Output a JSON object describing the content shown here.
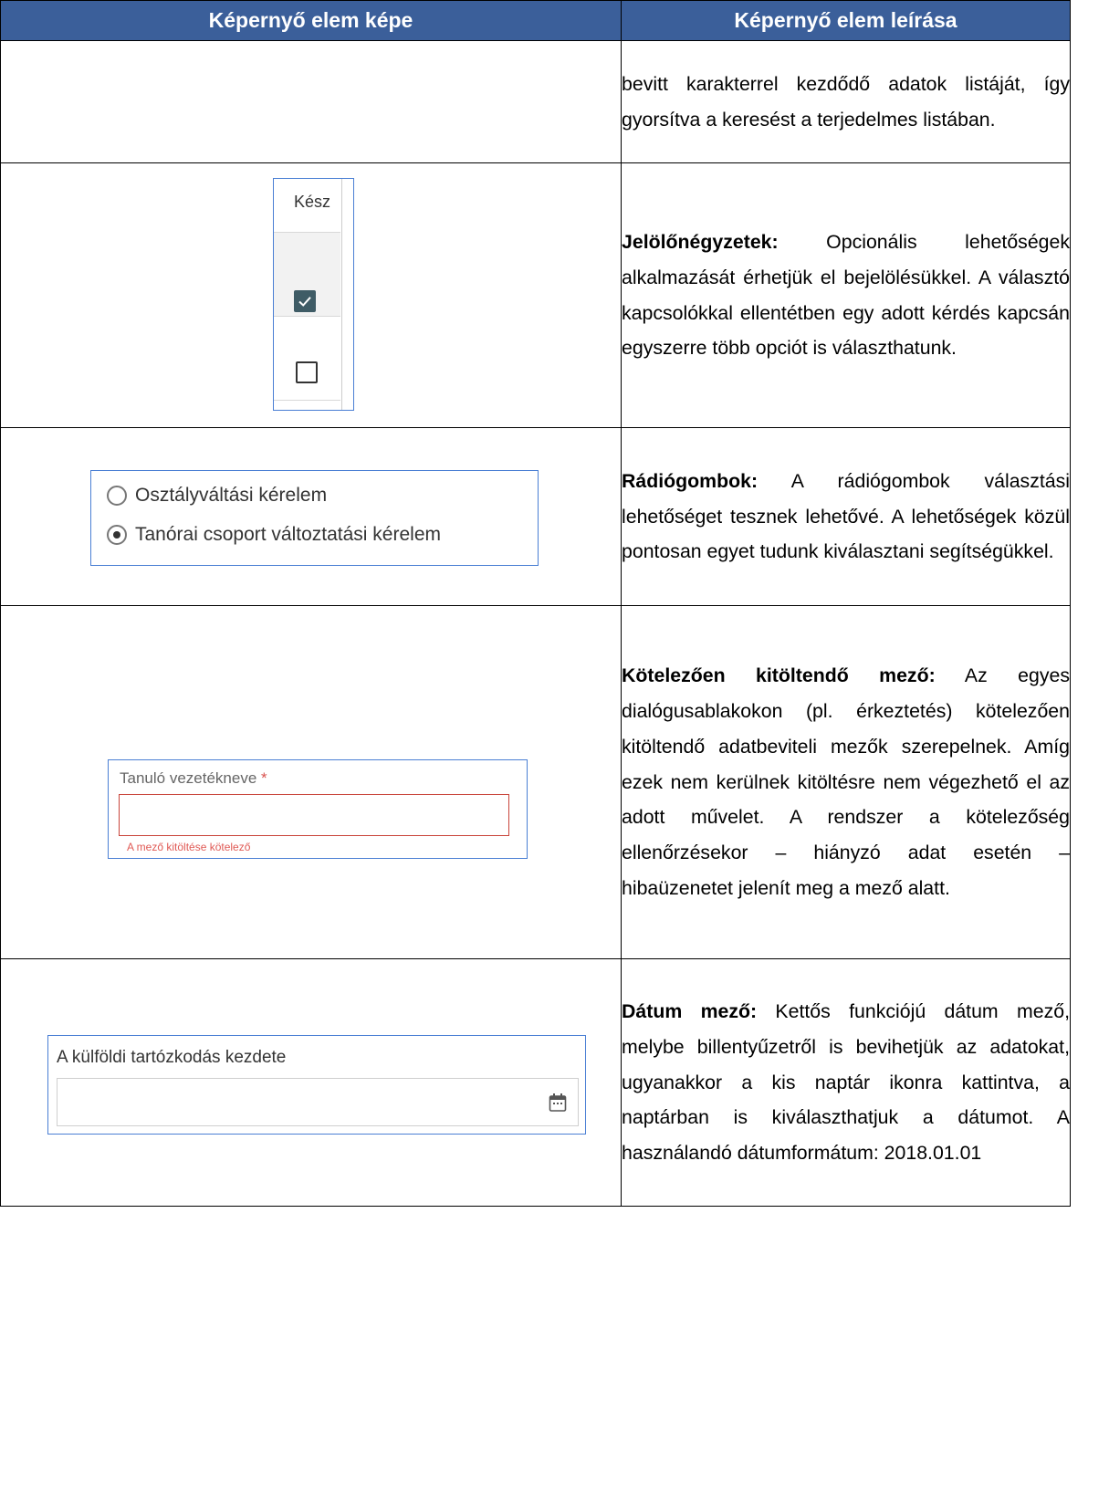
{
  "header": {
    "col1": "Képernyő elem képe",
    "col2": "Képernyő elem leírása"
  },
  "rows": [
    {
      "desc_bold": "",
      "desc_text": "bevitt karakterrel kezdődő adatok listáját, így gyorsítva a keresést a terjedelmes listában."
    },
    {
      "desc_bold": "Jelölőnégyzetek:",
      "desc_text": " Opcionális lehetőségek alkalmazását érhetjük el bejelölésükkel. A választó kapcsolókkal ellentétben egy adott kérdés kapcsán egyszerre több opciót is választhatunk.",
      "example": {
        "column_header": "Kész",
        "states": [
          "checked",
          "unchecked"
        ]
      }
    },
    {
      "desc_bold": "Rádiógombok:",
      "desc_text": " A rádiógombok választási lehetőséget tesznek lehetővé. A lehetőségek közül pontosan egyet tudunk kiválasztani segítségükkel.",
      "example": {
        "options": [
          "Osztályváltási kérelem",
          "Tanórai csoport változtatási kérelem"
        ],
        "selected_index": 1
      }
    },
    {
      "desc_bold": "Kötelezően kitöltendő mező:",
      "desc_text": " Az egyes dialógusablakokon (pl. érkeztetés) kötelezően kitöltendő adatbeviteli mezők szerepelnek. Amíg ezek nem kerülnek kitöltésre nem végezhető el az adott művelet. A rendszer a kötelezőség ellenőrzésekor – hiányzó adat esetén – hibaüzenetet jelenít meg a mező alatt.",
      "example": {
        "label": "Tanuló vezetékneve",
        "required_mark": "*",
        "value": "",
        "error": "A mező kitöltése kötelező"
      }
    },
    {
      "desc_bold": "Dátum mező:",
      "desc_text": " Kettős funkciójú dátum mező, melybe billentyűzetről is bevihetjük az adatokat, ugyanakkor a kis naptár ikonra kattintva, a naptárban is kiválaszthatjuk a dátumot. A használandó dátumformátum: 2018.01.01",
      "example": {
        "label": "A külföldi tartózkodás kezdete",
        "value": "",
        "icon": "calendar-icon"
      }
    }
  ],
  "colors": {
    "header_bg": "#3b5f9a",
    "example_border": "#4a7fd4",
    "checkbox_fill": "#3f5c66",
    "error": "#c9443a"
  }
}
